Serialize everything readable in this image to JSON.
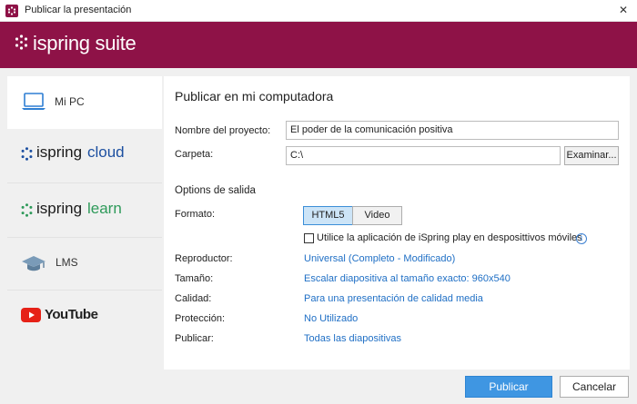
{
  "window": {
    "title": "Publicar la presentación",
    "close_glyph": "✕"
  },
  "brand": {
    "logo_text": "ispring suite"
  },
  "sidebar": {
    "items": [
      {
        "label": "Mi PC",
        "icon": "laptop-icon"
      },
      {
        "label_a": "ispring",
        "label_b": "cloud",
        "icon": "ispring-cloud-logo"
      },
      {
        "label_a": "ispring",
        "label_b": "learn",
        "icon": "ispring-learn-logo"
      },
      {
        "label": "LMS",
        "icon": "graduation-cap-icon"
      },
      {
        "label": "YouTube",
        "icon": "youtube-play-icon"
      }
    ]
  },
  "main": {
    "heading": "Publicar en mi computadora",
    "project_name_label": "Nombre del proyecto:",
    "project_name_value": "El poder de la comunicación positiva",
    "folder_label": "Carpeta:",
    "folder_value": "C:\\",
    "browse_button": "Examinar...",
    "output_options_heading": "Options de salida",
    "format_label": "Formato:",
    "format_options": [
      "HTML5",
      "Video"
    ],
    "format_selected": "HTML5",
    "mobile_checkbox_label": "Utilice la aplicación de iSpring play en desposittivos móviles",
    "mobile_checkbox_checked": false,
    "info_glyph": "i",
    "settings": [
      {
        "label": "Reproductor:",
        "value": "Universal (Completo - Modificado)"
      },
      {
        "label": "Tamaño:",
        "value": "Escalar diapositiva al tamaño exacto: 960x540"
      },
      {
        "label": "Calidad:",
        "value": "Para una presentación de calidad media"
      },
      {
        "label": "Protección:",
        "value": "No Utilizado"
      },
      {
        "label": "Publicar:",
        "value": "Todas las diapositivas"
      }
    ]
  },
  "footer": {
    "publish_button": "Publicar",
    "cancel_button": "Cancelar"
  },
  "colors": {
    "brand": "#8e1247",
    "link": "#1f6fc5",
    "primary_button": "#3f96e2",
    "ispring_cloud_blue": "#1c4fa0",
    "ispring_learn_green": "#2e9a5a",
    "youtube_red": "#e62117"
  }
}
